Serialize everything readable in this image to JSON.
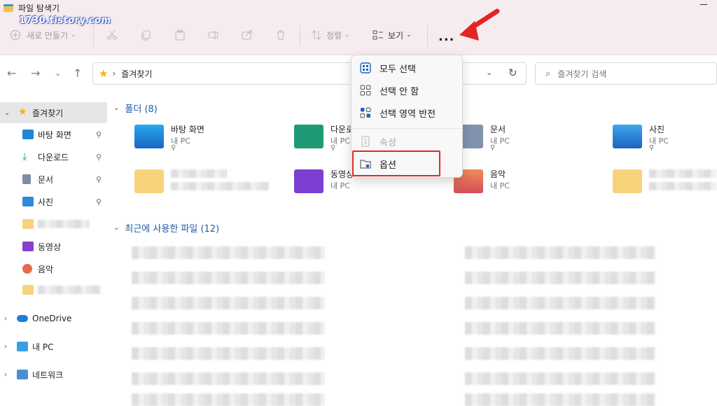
{
  "window": {
    "title": "파일 탐색기"
  },
  "watermark": "1730.tistory.com",
  "toolbar": {
    "new_label": "새로 만들기",
    "sort_label": "정렬",
    "view_label": "보기",
    "more_label": "..."
  },
  "address": {
    "crumb": "즐겨찾기",
    "separator": "›"
  },
  "search": {
    "placeholder": "즐겨찾기 검색"
  },
  "sidebar": {
    "items": [
      {
        "label": "즐겨찾기"
      },
      {
        "label": "바탕 화면"
      },
      {
        "label": "다운로드"
      },
      {
        "label": "문서"
      },
      {
        "label": "사진"
      },
      {
        "label": "동영상"
      },
      {
        "label": "음악"
      },
      {
        "label": "OneDrive"
      },
      {
        "label": "내 PC"
      },
      {
        "label": "네트워크"
      }
    ]
  },
  "sections": {
    "folders": "폴더 (8)",
    "recent": "최근에 사용한 파일 (12)"
  },
  "folders": [
    {
      "name": "바탕 화면",
      "sub": "내 PC"
    },
    {
      "name": "다운로드",
      "sub": "내 PC"
    },
    {
      "name": "문서",
      "sub": "내 PC"
    },
    {
      "name": "사진",
      "sub": "내 PC"
    },
    {
      "name": "동영상",
      "sub": "내 PC"
    },
    {
      "name": "음악",
      "sub": "내 PC"
    }
  ],
  "menu": {
    "items": [
      {
        "label": "모두 선택"
      },
      {
        "label": "선택 안 함"
      },
      {
        "label": "선택 영역 반전"
      },
      {
        "label": "속성"
      },
      {
        "label": "옵션"
      }
    ]
  },
  "colors": {
    "accent": "#1d5dab",
    "highlight": "#e52727",
    "title_bar": "#f6ecef"
  }
}
